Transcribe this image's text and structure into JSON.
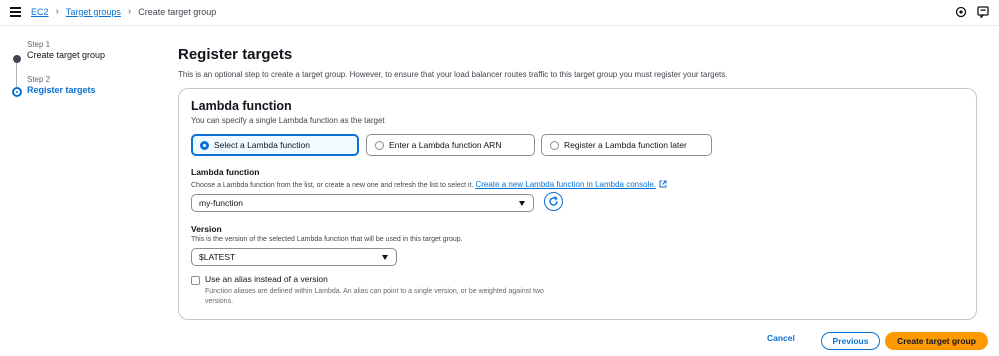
{
  "breadcrumb": {
    "items": [
      "EC2",
      "Target groups",
      "Create target group"
    ]
  },
  "steps": [
    {
      "num": "Step 1",
      "title": "Create target group"
    },
    {
      "num": "Step 2",
      "title": "Register targets"
    }
  ],
  "page": {
    "title": "Register targets",
    "description": "This is an optional step to create a target group. However, to ensure that your load balancer routes traffic to this target group you must register your targets."
  },
  "lambda": {
    "title": "Lambda function",
    "description": "You can specify a single Lambda function as the target",
    "options": [
      {
        "label": "Select a Lambda function",
        "selected": true
      },
      {
        "label": "Enter a Lambda function ARN",
        "selected": false
      },
      {
        "label": "Register a Lambda function later",
        "selected": false
      }
    ],
    "function_field": {
      "label": "Lambda function",
      "description": "Choose a Lambda function from the list, or create a new one and refresh the list to select it.",
      "link": "Create a new Lambda function in Lambda console.",
      "value": "my-function"
    },
    "version_field": {
      "label": "Version",
      "description": "This is the version of the selected Lambda function that will be used in this target group.",
      "value": "$LATEST"
    },
    "alias": {
      "label": "Use an alias instead of a version",
      "description": "Function aliases are defined within Lambda. An alias can point to a single version, or be weighted against two versions.",
      "checked": false
    }
  },
  "footer": {
    "cancel": "Cancel",
    "previous": "Previous",
    "create": "Create target group"
  },
  "colors": {
    "accent": "#0972d3",
    "primary_button": "#ff9900"
  },
  "icons": [
    "menu-icon",
    "chevron-right-icon",
    "settings-icon",
    "notifications-icon",
    "external-link-icon",
    "refresh-icon",
    "caret-down-icon"
  ]
}
